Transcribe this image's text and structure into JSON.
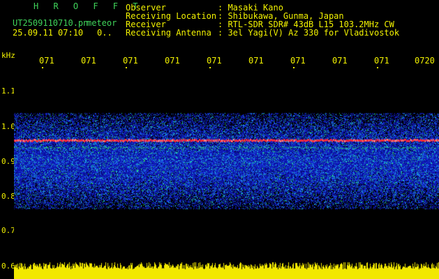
{
  "header": {
    "app_title": "H R O F F T",
    "file_name": "UT2509110710.pn",
    "label_meteor": "meteor",
    "datetime": "25.09.11 07:10",
    "count": "0..",
    "info": [
      {
        "label": "Observer",
        "value": ": Masaki Kano"
      },
      {
        "label": "Receiving Location",
        "value": ": Shibukawa, Gunma, Japan"
      },
      {
        "label": "Receiver",
        "value": ": RTL-SDR SDR# 43dB L15 103.2MHz CW"
      },
      {
        "label": "Receiving Antenna",
        "value": ": 3el Yagi(V) Az 330 for Vladivostok"
      }
    ]
  },
  "axes": {
    "y_unit": "kHz",
    "x_ticks": [
      "071",
      "071",
      "071",
      "071",
      "071",
      "071",
      "071",
      "071",
      "071",
      "0720"
    ],
    "y_ticks": [
      "1.1",
      "1.0",
      "0.9",
      "0.8",
      "0.7",
      "0.6"
    ]
  },
  "colors": {
    "text_green": "#3fd35a",
    "text_yellow": "#f2f200",
    "signal_red": "#ff2a3a",
    "noise_blue": "#1a2ad8",
    "background": "#000000"
  }
}
